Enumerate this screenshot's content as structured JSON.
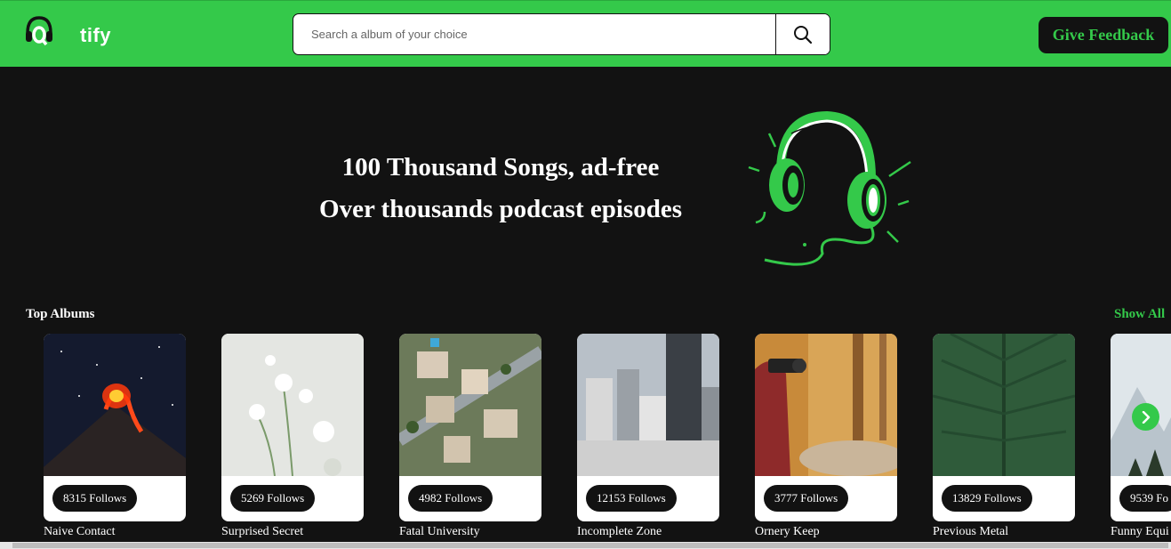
{
  "nav": {
    "logo_text": "tify",
    "search_placeholder": "Search a album of your choice",
    "search_value": "",
    "feedback_label": "Give Feedback"
  },
  "hero": {
    "line1": "100 Thousand Songs, ad-free",
    "line2": "Over thousands podcast episodes"
  },
  "section": {
    "title": "Top Albums",
    "show_all": "Show All"
  },
  "albums": [
    {
      "name": "Naive Contact",
      "follows": "8315 Follows",
      "image": "volcano-eruption"
    },
    {
      "name": "Surprised Secret",
      "follows": "5269 Follows",
      "image": "white-flowers"
    },
    {
      "name": "Fatal University",
      "follows": "4982 Follows",
      "image": "aerial-neighborhood"
    },
    {
      "name": "Incomplete Zone",
      "follows": "12153 Follows",
      "image": "city-skyline"
    },
    {
      "name": "Ornery Keep",
      "follows": "3777 Follows",
      "image": "photographer-autumn"
    },
    {
      "name": "Previous Metal",
      "follows": "13829 Follows",
      "image": "green-leaf"
    },
    {
      "name": "Funny Equi",
      "follows": "9539 Fo",
      "image": "snowy-mountain"
    }
  ],
  "colors": {
    "brand_green": "#34c94a",
    "background": "#121212",
    "card": "#ffffff"
  },
  "icons": {
    "search": "search-icon",
    "next": "chevron-right-icon",
    "logo": "headphones-logo-icon"
  }
}
